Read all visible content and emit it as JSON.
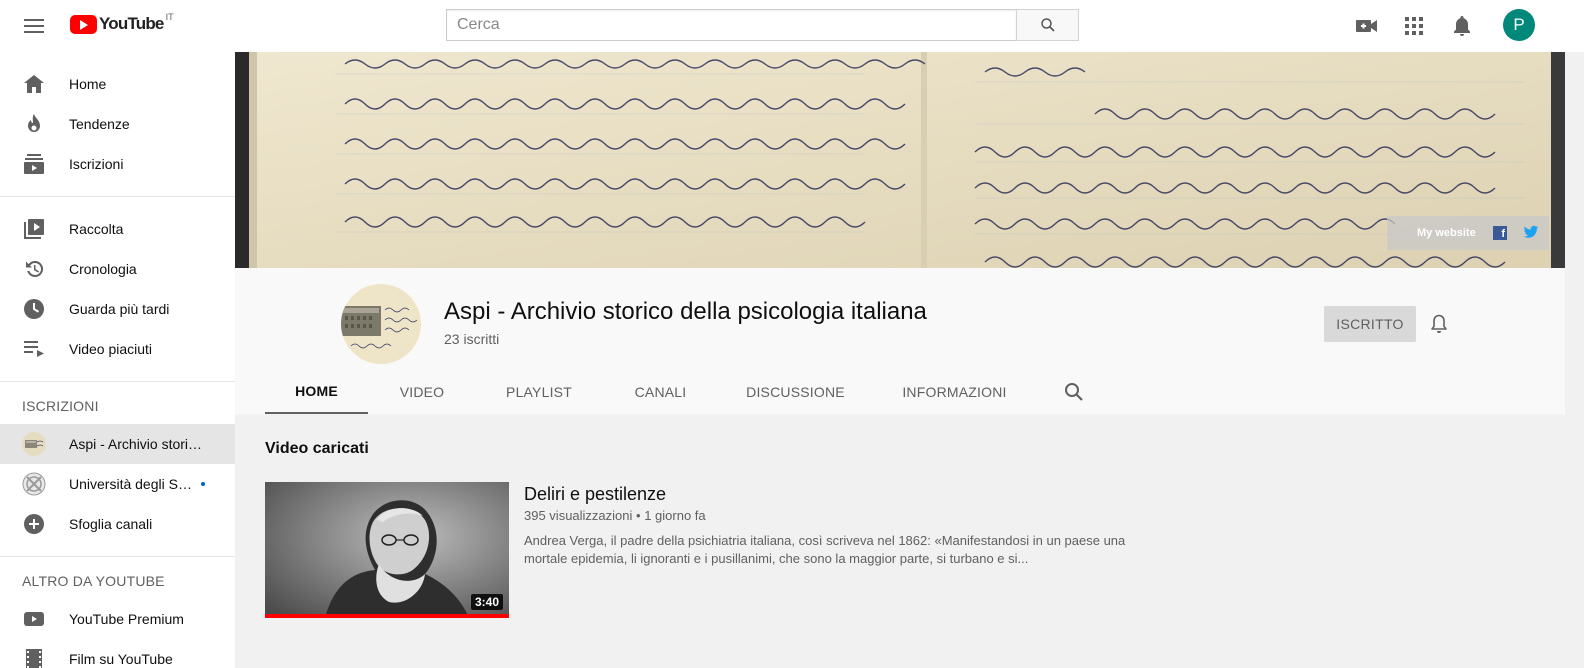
{
  "masthead": {
    "logo_text": "YouTube",
    "country": "IT",
    "search_placeholder": "Cerca",
    "avatar_letter": "P"
  },
  "sidebar": {
    "main": [
      {
        "label": "Home",
        "icon": "home-icon"
      },
      {
        "label": "Tendenze",
        "icon": "flame-icon"
      },
      {
        "label": "Iscrizioni",
        "icon": "subscriptions-icon"
      }
    ],
    "library": [
      {
        "label": "Raccolta",
        "icon": "library-icon"
      },
      {
        "label": "Cronologia",
        "icon": "history-icon"
      },
      {
        "label": "Guarda più tardi",
        "icon": "clock-icon"
      },
      {
        "label": "Video piaciuti",
        "icon": "playlist-icon"
      }
    ],
    "subscriptions_heading": "ISCRIZIONI",
    "subscriptions": [
      {
        "label": "Aspi - Archivio storico della psicologia italiana"
      },
      {
        "label": "Università degli Studi di Milano-Bicocca"
      },
      {
        "label": "Sfoglia canali"
      }
    ],
    "more_heading": "ALTRO DA YOUTUBE",
    "more": [
      {
        "label": "YouTube Premium"
      },
      {
        "label": "Film su YouTube"
      }
    ]
  },
  "banner": {
    "link_label": "My website",
    "fb_letter": "f",
    "colors": {
      "paper": "#e8dfc7",
      "ink": "#2b2f57"
    }
  },
  "channel": {
    "title": "Aspi - Archivio storico della psicologia italiana",
    "subscribers": "23 iscritti",
    "subscribed_label": "ISCRITTO",
    "tabs": [
      "HOME",
      "VIDEO",
      "PLAYLIST",
      "CANALI",
      "DISCUSSIONE",
      "INFORMAZIONI"
    ],
    "active_tab": "HOME"
  },
  "content": {
    "section_title": "Video caricati",
    "video": {
      "title": "Deliri e pestilenze",
      "views": "395 visualizzazioni",
      "age": "1 giorno fa",
      "duration": "3:40",
      "description": "Andrea Verga, il padre della psichiatria italiana, così scriveva nel 1862: «Manifestandosi in un paese una mortale epidemia, li ignoranti e i pusillanimi, che sono la maggior parte, si turbano e si..."
    }
  },
  "colors": {
    "brand_red": "#ff0000",
    "avatar_bg": "#00897b"
  }
}
